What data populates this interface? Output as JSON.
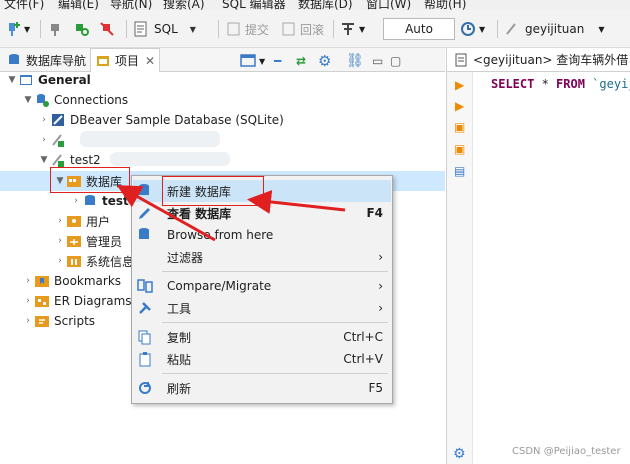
{
  "menubar": [
    "文件(F)",
    "编辑(E)",
    "导航(N)",
    "搜索(A)",
    "SQL 编辑器",
    "数据库(D)",
    "窗口(W)",
    "帮助(H)"
  ],
  "toolbar": {
    "sql_label": "SQL",
    "commit_label": "提交",
    "rollback_label": "回滚",
    "mode_value": "Auto",
    "user_value": "geyijituan"
  },
  "tabs": {
    "db_nav": "数据库导航",
    "project": "项目"
  },
  "tree": {
    "general": "General",
    "connections": "Connections",
    "sample_db": "DBeaver Sample Database (SQLite)",
    "test2": "test2",
    "databases": "数据库",
    "test_db": "test",
    "users": "用户",
    "admins": "管理员",
    "system_info": "系统信息",
    "bookmarks": "Bookmarks",
    "er_diagrams": "ER Diagrams",
    "scripts": "Scripts"
  },
  "editor": {
    "tab_title": "<geyijituan> 查询车辆外借",
    "sql_select": "SELECT",
    "sql_rest": " * ",
    "sql_from": "FROM",
    "sql_table": " `geyij"
  },
  "context_menu": {
    "new_db": "新建 数据库",
    "view_db": "查看 数据库",
    "view_db_shortcut": "F4",
    "browse": "Browse from here",
    "filter": "过滤器",
    "compare": "Compare/Migrate",
    "tools": "工具",
    "copy": "复制",
    "copy_shortcut": "Ctrl+C",
    "paste": "粘贴",
    "paste_shortcut": "Ctrl+V",
    "refresh": "刷新",
    "refresh_shortcut": "F5"
  },
  "watermark": "CSDN @Peijiao_tester",
  "colors": {
    "highlight": "#cce4f7",
    "selection": "#cde8ff",
    "annotation_red": "#e02020",
    "keyword": "#7f0055"
  }
}
